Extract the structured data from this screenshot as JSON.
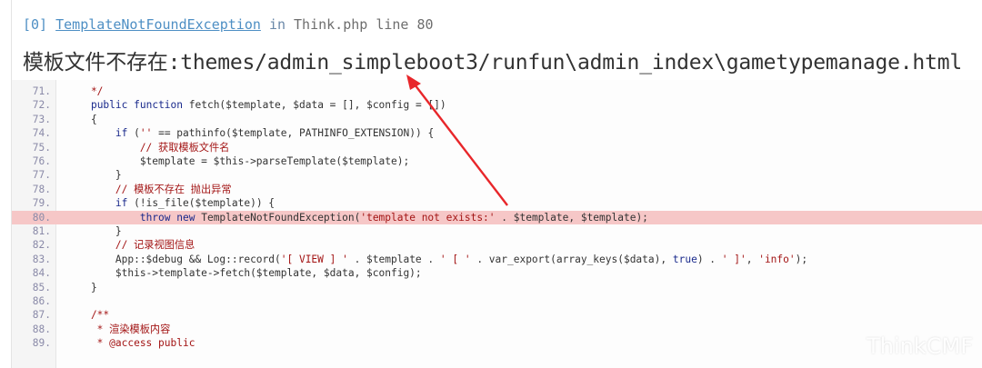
{
  "header": {
    "index": "[0]",
    "exception": "TemplateNotFoundException",
    "in_word": "in",
    "file": "Think.php line 80",
    "message": "模板文件不存在:themes/admin_simpleboot3/runfun\\admin_index\\gametypemanage.html"
  },
  "code": {
    "lines": [
      {
        "num": "71.",
        "text": "    */"
      },
      {
        "num": "72.",
        "text": "    public function fetch($template, $data = [], $config = [])"
      },
      {
        "num": "73.",
        "text": "    {"
      },
      {
        "num": "74.",
        "text": "        if ('' == pathinfo($template, PATHINFO_EXTENSION)) {"
      },
      {
        "num": "75.",
        "text": "            // 获取模板文件名"
      },
      {
        "num": "76.",
        "text": "            $template = $this->parseTemplate($template);"
      },
      {
        "num": "77.",
        "text": "        }"
      },
      {
        "num": "78.",
        "text": "        // 模板不存在 抛出异常"
      },
      {
        "num": "79.",
        "text": "        if (!is_file($template)) {"
      },
      {
        "num": "80.",
        "text": "            throw new TemplateNotFoundException('template not exists:' . $template, $template);"
      },
      {
        "num": "81.",
        "text": "        }"
      },
      {
        "num": "82.",
        "text": "        // 记录视图信息"
      },
      {
        "num": "83.",
        "text": "        App::$debug && Log::record('[ VIEW ] ' . $template . ' [ ' . var_export(array_keys($data), true) . ' ]', 'info');"
      },
      {
        "num": "84.",
        "text": "        $this->template->fetch($template, $data, $config);"
      },
      {
        "num": "85.",
        "text": "    }"
      },
      {
        "num": "86.",
        "text": ""
      },
      {
        "num": "87.",
        "text": "    /**"
      },
      {
        "num": "88.",
        "text": "     * 渲染模板内容"
      },
      {
        "num": "89.",
        "text": "     * @access public"
      }
    ],
    "highlight_line": "80."
  },
  "watermark": "ThinkCMF",
  "colors": {
    "highlight": "#f6c7c7",
    "arrow": "#e8262a",
    "link": "#4e8fc4"
  }
}
